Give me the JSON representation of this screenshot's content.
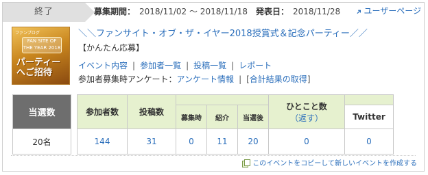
{
  "status": {
    "label": "終了"
  },
  "period": {
    "recruit_label": "募集期間：",
    "recruit_value": "2018/11/02 〜 2018/11/18",
    "announce_label": "発表日：",
    "announce_value": "2018/11/28"
  },
  "user_page": {
    "label": "ユーザーページ"
  },
  "thumbnail": {
    "small_text": "ファンブログ",
    "badge_text": "FAN SITE OF THE YEAR 2018",
    "big_text": "パーティーへご招待"
  },
  "event": {
    "title": "＼＼ファンサイト・オブ・ザ・イヤー2018授賞式＆記念パーティー／／",
    "subtitle": "【かんたん応募】"
  },
  "nav": {
    "items": [
      {
        "label": "イベント内容"
      },
      {
        "label": "参加者一覧"
      },
      {
        "label": "投稿一覧"
      },
      {
        "label": "レポート"
      }
    ]
  },
  "survey": {
    "prefix": "参加者募集時アンケート：",
    "info_label": "アンケート情報",
    "sep": "|",
    "bracket_open": "[",
    "result_label": "合計結果の取得",
    "bracket_close": "]"
  },
  "winners": {
    "header": "当選数",
    "value": "20名"
  },
  "counts": {
    "headers": {
      "participants": "参加者数",
      "posts": "投稿数",
      "at_recruit": "募集時",
      "intro": "紹介",
      "after_win": "当選後",
      "comment": "ひとこと数",
      "comment_reply": "（返す）",
      "twitter": "Twitter"
    },
    "values": {
      "participants": "144",
      "posts": "31",
      "at_recruit": "0",
      "intro": "11",
      "after_win": "20",
      "comment": "0",
      "twitter": "0"
    }
  },
  "copy": {
    "label": "このイベントをコピーして新しいイベントを作成する"
  },
  "colors": {
    "link": "#2a6ebb",
    "header_green": "#e6f1cf",
    "header_gray": "#6e6e6e",
    "tab_gray": "#e0e0e0"
  }
}
